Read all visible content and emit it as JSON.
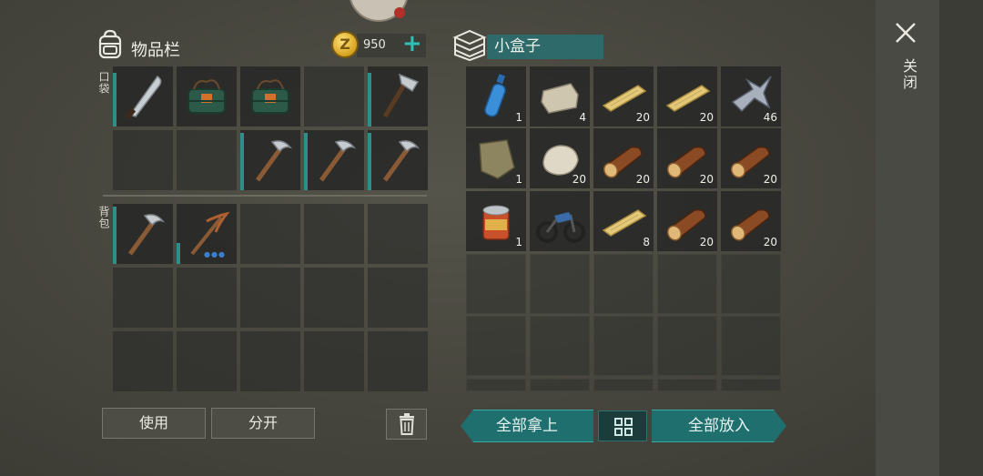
{
  "inventory": {
    "title": "物品栏",
    "coins": "950",
    "pocket_label": "口袋",
    "backpack_label": "背包",
    "pocket_slots": [
      {
        "item": "machete-icon",
        "durability": 0.9,
        "count": ""
      },
      {
        "item": "dynamite-icon",
        "durability": 0,
        "count": ""
      },
      {
        "item": "dynamite-icon",
        "durability": 0,
        "count": ""
      },
      {
        "item": "",
        "durability": 0,
        "count": ""
      },
      {
        "item": "hatchet-icon",
        "durability": 0.9,
        "count": ""
      },
      {
        "item": "",
        "durability": 0,
        "count": ""
      },
      {
        "item": "",
        "durability": 0,
        "count": ""
      },
      {
        "item": "pickaxe-icon",
        "durability": 0.95,
        "count": ""
      },
      {
        "item": "pickaxe-icon",
        "durability": 0.95,
        "count": ""
      },
      {
        "item": "pickaxe-icon",
        "durability": 0.95,
        "count": ""
      }
    ],
    "backpack_slots": [
      {
        "item": "pickaxe-icon",
        "durability": 0.95,
        "count": "",
        "dots": ""
      },
      {
        "item": "iron-pickaxe-icon",
        "durability": 0.35,
        "count": "",
        "dots": "●●●"
      },
      {
        "item": "",
        "durability": 0,
        "count": "",
        "dots": ""
      },
      {
        "item": "",
        "durability": 0,
        "count": "",
        "dots": ""
      },
      {
        "item": "",
        "durability": 0,
        "count": "",
        "dots": ""
      },
      {
        "item": "",
        "durability": 0,
        "count": "",
        "dots": ""
      },
      {
        "item": "",
        "durability": 0,
        "count": "",
        "dots": ""
      },
      {
        "item": "",
        "durability": 0,
        "count": "",
        "dots": ""
      },
      {
        "item": "",
        "durability": 0,
        "count": "",
        "dots": ""
      },
      {
        "item": "",
        "durability": 0,
        "count": "",
        "dots": ""
      },
      {
        "item": "",
        "durability": 0,
        "count": "",
        "dots": ""
      },
      {
        "item": "",
        "durability": 0,
        "count": "",
        "dots": ""
      },
      {
        "item": "",
        "durability": 0,
        "count": "",
        "dots": ""
      },
      {
        "item": "",
        "durability": 0,
        "count": "",
        "dots": ""
      },
      {
        "item": "",
        "durability": 0,
        "count": "",
        "dots": ""
      }
    ],
    "use_label": "使用",
    "split_label": "分开"
  },
  "container": {
    "title": "小盒子",
    "slots": [
      {
        "item": "water-bottle-icon",
        "count": "1"
      },
      {
        "item": "stone-block-icon",
        "count": "4"
      },
      {
        "item": "plank-icon",
        "count": "20"
      },
      {
        "item": "plank-icon",
        "count": "20"
      },
      {
        "item": "metal-scrap-icon",
        "count": "46"
      },
      {
        "item": "cloth-icon",
        "count": "1"
      },
      {
        "item": "stone-icon",
        "count": "20"
      },
      {
        "item": "log-icon",
        "count": "20"
      },
      {
        "item": "log-icon",
        "count": "20"
      },
      {
        "item": "log-icon",
        "count": "20"
      },
      {
        "item": "canned-food-icon",
        "count": "1"
      },
      {
        "item": "motorcycle-icon",
        "count": ""
      },
      {
        "item": "plank-icon",
        "count": "8"
      },
      {
        "item": "log-icon",
        "count": "20"
      },
      {
        "item": "log-icon",
        "count": "20"
      }
    ],
    "take_all_label": "全部拿上",
    "put_all_label": "全部放入"
  },
  "close_label": "关闭",
  "colors": {
    "accent": "#2fc0b4",
    "teal_button": "#1f6f6e",
    "durability": "#2c8f8a"
  }
}
